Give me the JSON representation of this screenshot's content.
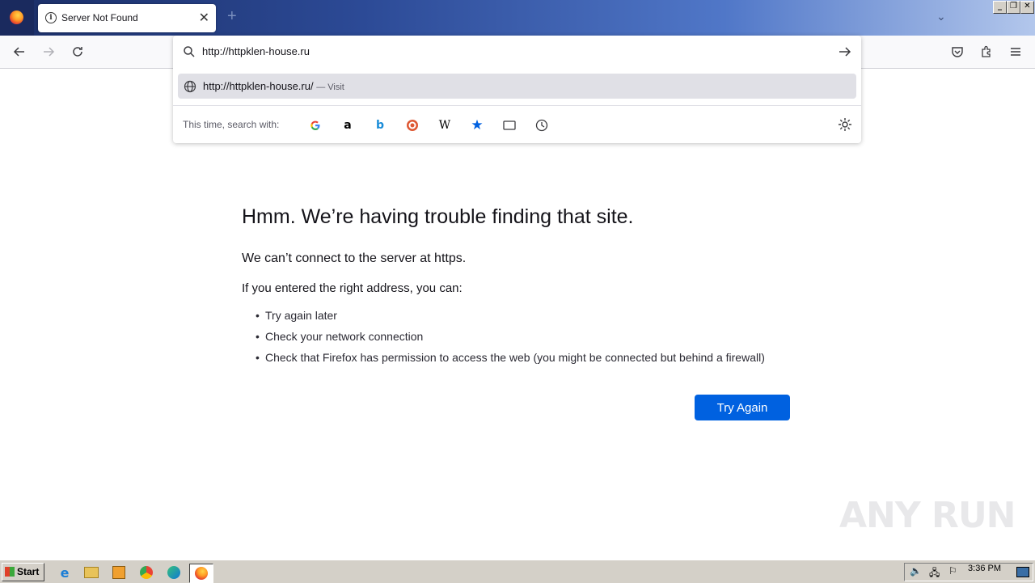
{
  "tab": {
    "title": "Server Not Found"
  },
  "urlbar": {
    "value": "http://httpklen-house.ru",
    "suggestion_url": "http://httpklen-house.ru/",
    "suggestion_action": "— Visit",
    "search_with_label": "This time, search with:",
    "engines": [
      "google-icon",
      "amazon-icon",
      "bing-icon",
      "duckduckgo-icon",
      "wikipedia-icon",
      "bookmarks-icon",
      "tabs-icon",
      "history-icon"
    ]
  },
  "error": {
    "title": "Hmm. We’re having trouble finding that site.",
    "description": "We can’t connect to the server at https.",
    "subtitle": "If you entered the right address, you can:",
    "suggestions": [
      "Try again later",
      "Check your network connection",
      "Check that Firefox has permission to access the web (you might be connected but behind a firewall)"
    ],
    "button": "Try Again"
  },
  "watermark": "ANY RUN",
  "taskbar": {
    "start_label": "Start",
    "clock": "3:36 PM"
  },
  "colors": {
    "accent": "#0061e0",
    "titlebar": "#2c4a96"
  }
}
